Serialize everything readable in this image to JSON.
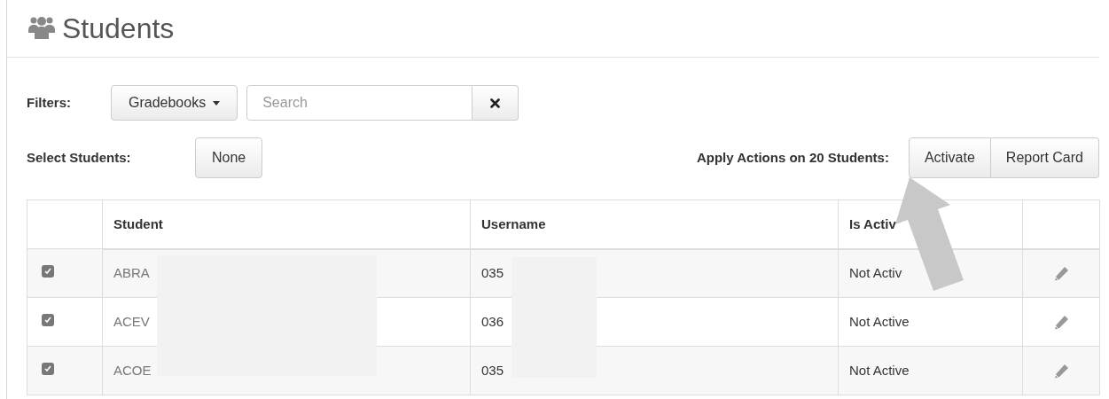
{
  "page": {
    "title": "Students"
  },
  "filters": {
    "label": "Filters:",
    "gradebooks_button": "Gradebooks",
    "search": {
      "placeholder": "Search"
    }
  },
  "selection": {
    "label": "Select Students:",
    "none_button": "None"
  },
  "actions": {
    "label": "Apply Actions on 20 Students:",
    "buttons": [
      "Activate",
      "Report Card"
    ]
  },
  "annotation_arrow": true,
  "table": {
    "redacted": true,
    "columns": [
      "Student",
      "Username",
      "Is Activ"
    ],
    "rows": [
      {
        "checked": true,
        "student": "ABRA",
        "username": "035",
        "is_active": "Not Activ"
      },
      {
        "checked": true,
        "student": "ACEV",
        "username": "036",
        "is_active": "Not Active"
      },
      {
        "checked": true,
        "student": "ACOE",
        "username": "035",
        "is_active": "Not Active"
      }
    ]
  }
}
